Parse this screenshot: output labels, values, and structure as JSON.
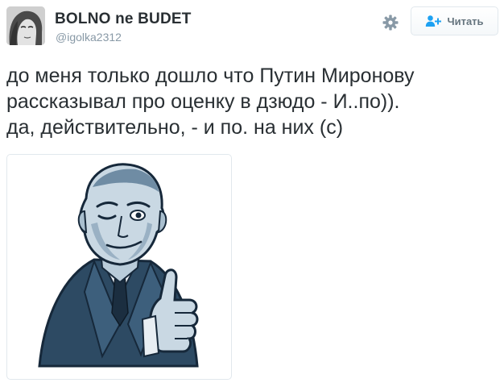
{
  "tweet": {
    "display_name": "BOLNO ne BUDET",
    "screen_name": "@igolka2312",
    "text_lines": [
      "до меня только дошло что Путин Миронову",
      "рассказывал про оценку в дзюдо - И..по)).",
      "да, действительно, - и по. на них (с)"
    ]
  },
  "actions": {
    "follow_label": "Читать",
    "gear_icon": "gear-icon",
    "follow_icon": "user-plus-icon"
  },
  "media": {
    "type": "sticker",
    "icon": "winking-man-thumbs-up-sticker"
  },
  "colors": {
    "text": "#292f33",
    "muted": "#8899a6",
    "button_text": "#66757f",
    "sticker_dark": "#2d4a63",
    "sticker_mid": "#5f7f99",
    "sticker_light": "#c9d8e3"
  }
}
